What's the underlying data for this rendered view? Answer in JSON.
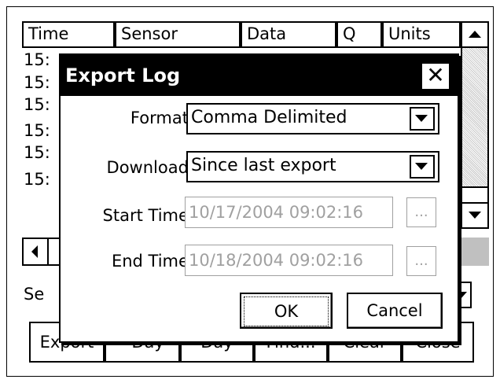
{
  "table": {
    "columns": [
      "Time",
      "Sensor",
      "Data",
      "Q",
      "Units"
    ],
    "rows": [
      "15:",
      "15:",
      "15:",
      "15:",
      "15:",
      "15:"
    ]
  },
  "bottom": {
    "select_label": "Se",
    "buttons": [
      "Export",
      "- Day",
      "Day",
      "Find...",
      "Clear",
      "Close"
    ]
  },
  "dialog": {
    "title": "Export Log",
    "close_glyph": "✕",
    "format_label": "Format:",
    "format_value": "Comma Delimited",
    "download_label": "Download:",
    "download_value": "Since last export",
    "start_label": "Start Time:",
    "start_value": "10/17/2004 09:02:16",
    "end_label": "End Time:",
    "end_value": "10/18/2004 09:02:16",
    "browse_glyph": "...",
    "ok_label": "OK",
    "cancel_label": "Cancel"
  }
}
